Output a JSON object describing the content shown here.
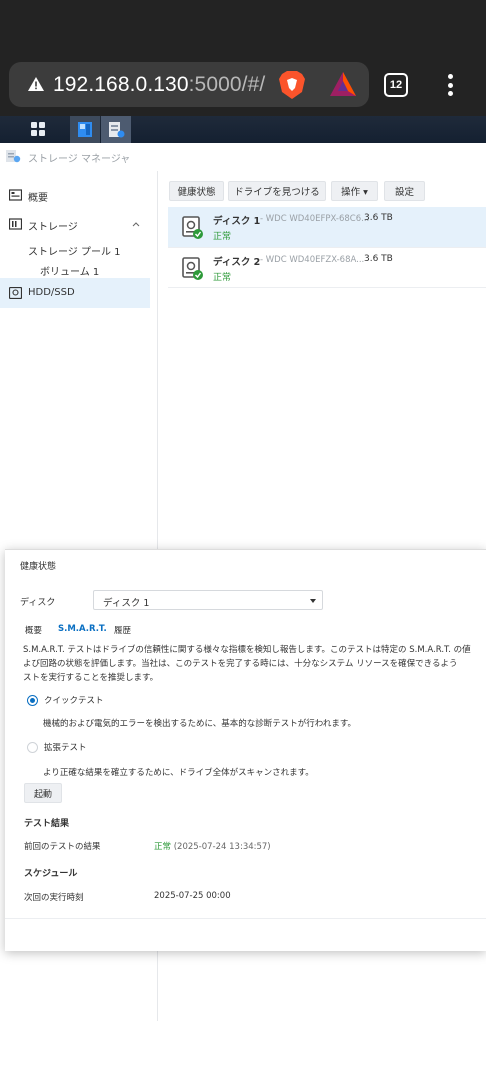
{
  "browser": {
    "url_host": "192.168.0.130",
    "url_rest": ":5000/#/",
    "tab_count": "12"
  },
  "app": {
    "title": "ストレージ マネージャ"
  },
  "sidebar": {
    "overview": "概要",
    "storage": "ストレージ",
    "pool": "ストレージ プール 1",
    "volume": "ボリューム 1",
    "hdd": "HDD/SSD"
  },
  "toolbar": {
    "health": "健康状態",
    "locate": "ドライブを見つける",
    "action": "操作 ▾",
    "settings": "設定"
  },
  "disks": [
    {
      "name": "ディスク 1",
      "model": "- WDC WD40EFPX-68C6...",
      "size": "3.6 TB",
      "status": "正常"
    },
    {
      "name": "ディスク 2",
      "model": "- WDC WD40EFZX-68A...",
      "size": "3.6 TB",
      "status": "正常"
    }
  ],
  "dialog": {
    "title": "健康状態",
    "disk_label": "ディスク",
    "disk_value": "ディスク 1",
    "tabs": [
      "概要",
      "S.M.A.R.T.",
      "履歴"
    ],
    "desc_line1": "S.M.A.R.T. テストはドライブの信頼性に関する様々な指標を検知し報告します。このテストは特定の S.M.A.R.T. の値",
    "desc_line2": "よび回路の状態を評価します。当社は、このテストを完了する時には、十分なシステム リソースを確保できるよう",
    "desc_line3": "ストを実行することを推奨します。",
    "quick_test": "クイックテスト",
    "quick_desc": "機械的および電気的エラーを検出するために、基本的な診断テストが行われます。",
    "extended_test": "拡張テスト",
    "extended_desc": "より正確な結果を確立するために、ドライブ全体がスキャンされます。",
    "start": "起動",
    "result_title": "テスト結果",
    "last_result_label": "前回のテストの結果",
    "last_result_status": "正常",
    "last_result_time": " (2025-07-24 13:34:57)",
    "schedule_title": "スケジュール",
    "next_run_label": "次回の実行時刻",
    "next_run_value": "2025-07-25 00:00"
  },
  "colors": {
    "accent": "#0a6fc2",
    "ok": "#2e9a3a",
    "selected": "#e5f1fb"
  }
}
